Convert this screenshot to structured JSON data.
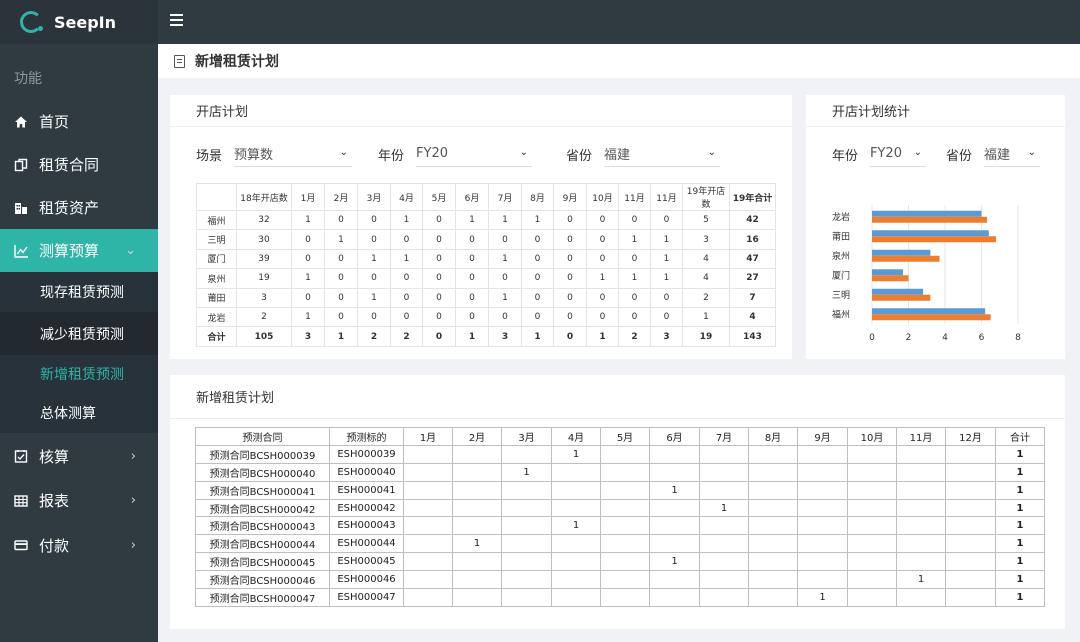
{
  "app": {
    "name": "SeepIn"
  },
  "sidebar": {
    "section": "功能",
    "items": [
      {
        "label": "首页",
        "icon": "home-icon"
      },
      {
        "label": "租赁合同",
        "icon": "contract-icon"
      },
      {
        "label": "租赁资产",
        "icon": "asset-icon"
      },
      {
        "label": "测算预算",
        "icon": "chart-icon"
      }
    ],
    "sub_items": [
      "现存租赁预测",
      "减少租赁预测",
      "新增租赁预测",
      "总体测算"
    ],
    "items_bottom": [
      {
        "label": "核算",
        "icon": "checklist-icon"
      },
      {
        "label": "报表",
        "icon": "table-icon"
      },
      {
        "label": "付款",
        "icon": "card-icon"
      }
    ]
  },
  "page": {
    "title": "新增租赁计划"
  },
  "open_plan": {
    "title": "开店计划",
    "filters": [
      {
        "label": "场景",
        "value": "预算数"
      },
      {
        "label": "年份",
        "value": "FY20"
      },
      {
        "label": "省份",
        "value": "福建"
      }
    ],
    "headers": [
      "",
      "18年开店数",
      "1月",
      "2月",
      "3月",
      "4月",
      "5月",
      "6月",
      "7月",
      "8月",
      "9月",
      "10月",
      "11月",
      "11月",
      "19年开店数",
      "19年合计"
    ],
    "rows": [
      [
        "福州",
        "32",
        "1",
        "0",
        "0",
        "1",
        "0",
        "1",
        "1",
        "1",
        "0",
        "0",
        "0",
        "0",
        "5",
        "42"
      ],
      [
        "三明",
        "30",
        "0",
        "1",
        "0",
        "0",
        "0",
        "0",
        "0",
        "0",
        "0",
        "0",
        "1",
        "1",
        "3",
        "16"
      ],
      [
        "厦门",
        "39",
        "0",
        "0",
        "1",
        "1",
        "0",
        "0",
        "1",
        "0",
        "0",
        "0",
        "0",
        "1",
        "4",
        "47"
      ],
      [
        "泉州",
        "19",
        "1",
        "0",
        "0",
        "0",
        "0",
        "0",
        "0",
        "0",
        "0",
        "1",
        "1",
        "1",
        "4",
        "27"
      ],
      [
        "莆田",
        "3",
        "0",
        "0",
        "1",
        "0",
        "0",
        "0",
        "1",
        "0",
        "0",
        "0",
        "0",
        "0",
        "2",
        "7"
      ],
      [
        "龙岩",
        "2",
        "1",
        "0",
        "0",
        "0",
        "0",
        "0",
        "0",
        "0",
        "0",
        "0",
        "0",
        "0",
        "1",
        "4"
      ]
    ],
    "total": [
      "合计",
      "105",
      "3",
      "1",
      "2",
      "2",
      "0",
      "1",
      "3",
      "1",
      "0",
      "1",
      "2",
      "3",
      "19",
      "143"
    ]
  },
  "stats": {
    "title": "开店计划统计",
    "filters": [
      {
        "label": "年份",
        "value": "FY20"
      },
      {
        "label": "省份",
        "value": "福建"
      }
    ]
  },
  "chart_data": {
    "type": "bar",
    "orientation": "horizontal",
    "categories": [
      "龙岩",
      "莆田",
      "泉州",
      "厦门",
      "三明",
      "福州"
    ],
    "series": [
      {
        "values": [
          6.0,
          6.4,
          3.2,
          1.7,
          2.8,
          6.2
        ],
        "color": "#5b9bd5"
      },
      {
        "values": [
          6.3,
          6.8,
          3.7,
          2.0,
          3.2,
          6.5
        ],
        "color": "#ed7d31"
      }
    ],
    "xticks": [
      "0",
      "2",
      "4",
      "6",
      "8"
    ],
    "xlim": [
      0,
      8
    ],
    "grid": true
  },
  "new_plan": {
    "title": "新增租赁计划",
    "headers": [
      "预测合同",
      "预测标的",
      "1月",
      "2月",
      "3月",
      "4月",
      "5月",
      "6月",
      "7月",
      "8月",
      "9月",
      "10月",
      "11月",
      "12月",
      "合计"
    ],
    "rows": [
      {
        "contract": "预测合同BCSH000039",
        "target": "ESH000039",
        "month": 4,
        "total": "1"
      },
      {
        "contract": "预测合同BCSH000040",
        "target": "ESH000040",
        "month": 3,
        "total": "1"
      },
      {
        "contract": "预测合同BCSH000041",
        "target": "ESH000041",
        "month": 6,
        "total": "1"
      },
      {
        "contract": "预测合同BCSH000042",
        "target": "ESH000042",
        "month": 7,
        "total": "1"
      },
      {
        "contract": "预测合同BCSH000043",
        "target": "ESH000043",
        "month": 4,
        "total": "1"
      },
      {
        "contract": "预测合同BCSH000044",
        "target": "ESH000044",
        "month": 2,
        "total": "1"
      },
      {
        "contract": "预测合同BCSH000045",
        "target": "ESH000045",
        "month": 6,
        "total": "1"
      },
      {
        "contract": "预测合同BCSH000046",
        "target": "ESH000046",
        "month": 11,
        "total": "1"
      },
      {
        "contract": "预测合同BCSH000047",
        "target": "ESH000047",
        "month": 9,
        "total": "1"
      }
    ],
    "cell_value": "1"
  }
}
